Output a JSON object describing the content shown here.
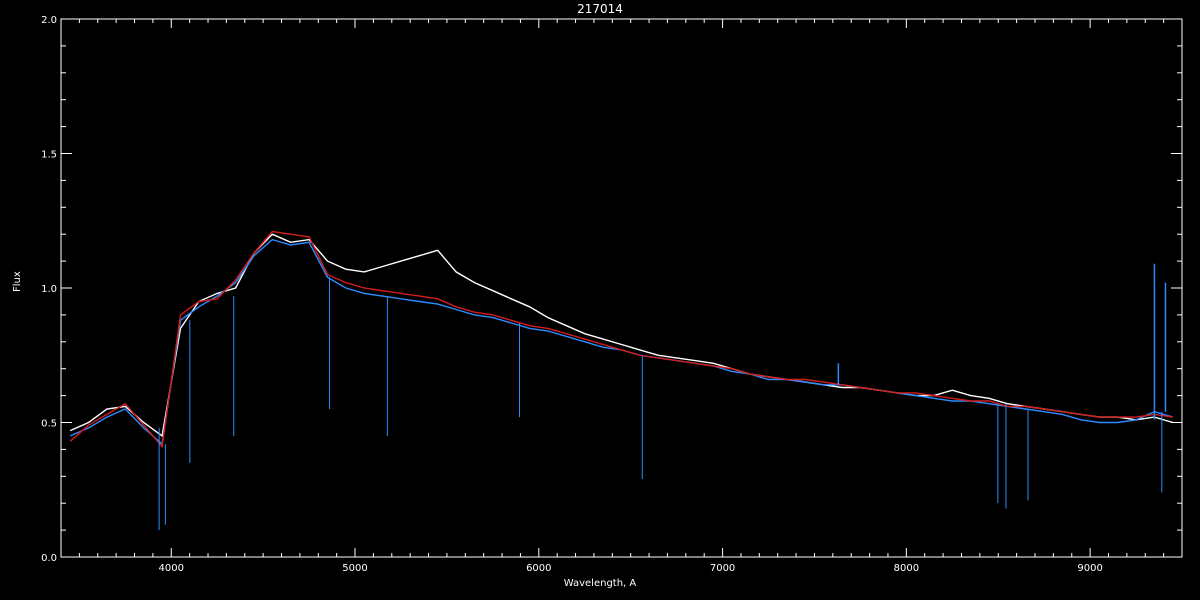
{
  "chart_data": {
    "type": "line",
    "title": "217014",
    "xlabel": "Wavelength, A",
    "ylabel": "Flux",
    "xlim": [
      3400,
      9500
    ],
    "ylim": [
      0.0,
      2.0
    ],
    "xticks": [
      4000,
      5000,
      6000,
      7000,
      8000,
      9000
    ],
    "xtick_labels": [
      "4000",
      "5000",
      "6000",
      "7000",
      "8000",
      "9000"
    ],
    "yticks": [
      0.0,
      0.5,
      1.0,
      1.5,
      2.0
    ],
    "ytick_labels": [
      "0.0",
      "0.5",
      "1.0",
      "1.5",
      "2.0"
    ],
    "grid": false,
    "series": [
      {
        "color": "#ffffff",
        "x": [
          3450,
          3550,
          3650,
          3750,
          3850,
          3950,
          4050,
          4150,
          4250,
          4350,
          4450,
          4550,
          4650,
          4750,
          4850,
          4950,
          5050,
          5150,
          5250,
          5350,
          5450,
          5550,
          5650,
          5750,
          5850,
          5950,
          6050,
          6150,
          6250,
          6350,
          6450,
          6550,
          6650,
          6750,
          6850,
          6950,
          7050,
          7150,
          7250,
          7350,
          7450,
          7550,
          7650,
          7750,
          7850,
          7950,
          8050,
          8150,
          8250,
          8350,
          8450,
          8550,
          8650,
          8750,
          8850,
          8950,
          9050,
          9150,
          9250,
          9350,
          9450
        ],
        "values": [
          0.47,
          0.5,
          0.55,
          0.56,
          0.5,
          0.45,
          0.85,
          0.95,
          0.98,
          1.0,
          1.13,
          1.2,
          1.17,
          1.18,
          1.1,
          1.07,
          1.06,
          1.08,
          1.1,
          1.12,
          1.14,
          1.06,
          1.02,
          0.99,
          0.96,
          0.93,
          0.89,
          0.86,
          0.83,
          0.81,
          0.79,
          0.77,
          0.75,
          0.74,
          0.73,
          0.72,
          0.7,
          0.68,
          0.67,
          0.66,
          0.65,
          0.64,
          0.63,
          0.63,
          0.62,
          0.61,
          0.6,
          0.6,
          0.62,
          0.6,
          0.59,
          0.57,
          0.56,
          0.55,
          0.54,
          0.53,
          0.52,
          0.52,
          0.51,
          0.52,
          0.5
        ]
      },
      {
        "color": "#2e8bff",
        "x": [
          3450,
          3550,
          3650,
          3750,
          3850,
          3950,
          4050,
          4150,
          4250,
          4350,
          4450,
          4550,
          4650,
          4750,
          4850,
          4950,
          5050,
          5150,
          5250,
          5350,
          5450,
          5550,
          5650,
          5750,
          5850,
          5950,
          6050,
          6150,
          6250,
          6350,
          6450,
          6550,
          6650,
          6750,
          6850,
          6950,
          7050,
          7150,
          7250,
          7350,
          7450,
          7550,
          7650,
          7750,
          7850,
          7950,
          8050,
          8150,
          8250,
          8350,
          8450,
          8550,
          8650,
          8750,
          8850,
          8950,
          9050,
          9150,
          9250,
          9350,
          9450
        ],
        "values": [
          0.45,
          0.48,
          0.52,
          0.55,
          0.48,
          0.42,
          0.88,
          0.93,
          0.97,
          1.02,
          1.12,
          1.18,
          1.16,
          1.17,
          1.04,
          1.0,
          0.98,
          0.97,
          0.96,
          0.95,
          0.94,
          0.92,
          0.9,
          0.89,
          0.87,
          0.85,
          0.84,
          0.82,
          0.8,
          0.78,
          0.77,
          0.75,
          0.74,
          0.73,
          0.72,
          0.71,
          0.69,
          0.68,
          0.66,
          0.66,
          0.65,
          0.64,
          0.64,
          0.63,
          0.62,
          0.61,
          0.6,
          0.59,
          0.58,
          0.58,
          0.57,
          0.56,
          0.55,
          0.54,
          0.53,
          0.51,
          0.5,
          0.5,
          0.51,
          0.54,
          0.52
        ]
      },
      {
        "color": "#d41c1c",
        "x": [
          3450,
          3550,
          3650,
          3750,
          3850,
          3950,
          4050,
          4150,
          4250,
          4350,
          4450,
          4550,
          4650,
          4750,
          4850,
          4950,
          5050,
          5150,
          5250,
          5350,
          5450,
          5550,
          5650,
          5750,
          5850,
          5950,
          6050,
          6150,
          6250,
          6350,
          6450,
          6550,
          6650,
          6750,
          6850,
          6950,
          7050,
          7150,
          7250,
          7350,
          7450,
          7550,
          7650,
          7750,
          7850,
          7950,
          8050,
          8150,
          8250,
          8350,
          8450,
          8550,
          8650,
          8750,
          8850,
          8950,
          9050,
          9150,
          9250,
          9350,
          9450
        ],
        "values": [
          0.43,
          0.49,
          0.53,
          0.57,
          0.49,
          0.41,
          0.9,
          0.95,
          0.96,
          1.03,
          1.13,
          1.21,
          1.2,
          1.19,
          1.05,
          1.02,
          1.0,
          0.99,
          0.98,
          0.97,
          0.96,
          0.93,
          0.91,
          0.9,
          0.88,
          0.86,
          0.85,
          0.83,
          0.81,
          0.79,
          0.77,
          0.75,
          0.74,
          0.73,
          0.72,
          0.71,
          0.7,
          0.68,
          0.67,
          0.66,
          0.66,
          0.65,
          0.64,
          0.63,
          0.62,
          0.61,
          0.61,
          0.6,
          0.59,
          0.58,
          0.58,
          0.56,
          0.56,
          0.55,
          0.54,
          0.53,
          0.52,
          0.52,
          0.52,
          0.53,
          0.52
        ]
      }
    ],
    "absorption_lines": [
      {
        "x": 3934,
        "y": 0.1
      },
      {
        "x": 3968,
        "y": 0.12
      },
      {
        "x": 4101,
        "y": 0.35
      },
      {
        "x": 4340,
        "y": 0.45
      },
      {
        "x": 4861,
        "y": 0.55
      },
      {
        "x": 5176,
        "y": 0.45
      },
      {
        "x": 5895,
        "y": 0.52
      },
      {
        "x": 6563,
        "y": 0.29
      },
      {
        "x": 8498,
        "y": 0.2
      },
      {
        "x": 8542,
        "y": 0.18
      },
      {
        "x": 8662,
        "y": 0.21
      },
      {
        "x": 9390,
        "y": 0.24
      }
    ],
    "emission_features": [
      {
        "x": 7630,
        "y": 0.72
      },
      {
        "x": 9350,
        "y": 1.09
      },
      {
        "x": 9410,
        "y": 1.02
      }
    ]
  }
}
